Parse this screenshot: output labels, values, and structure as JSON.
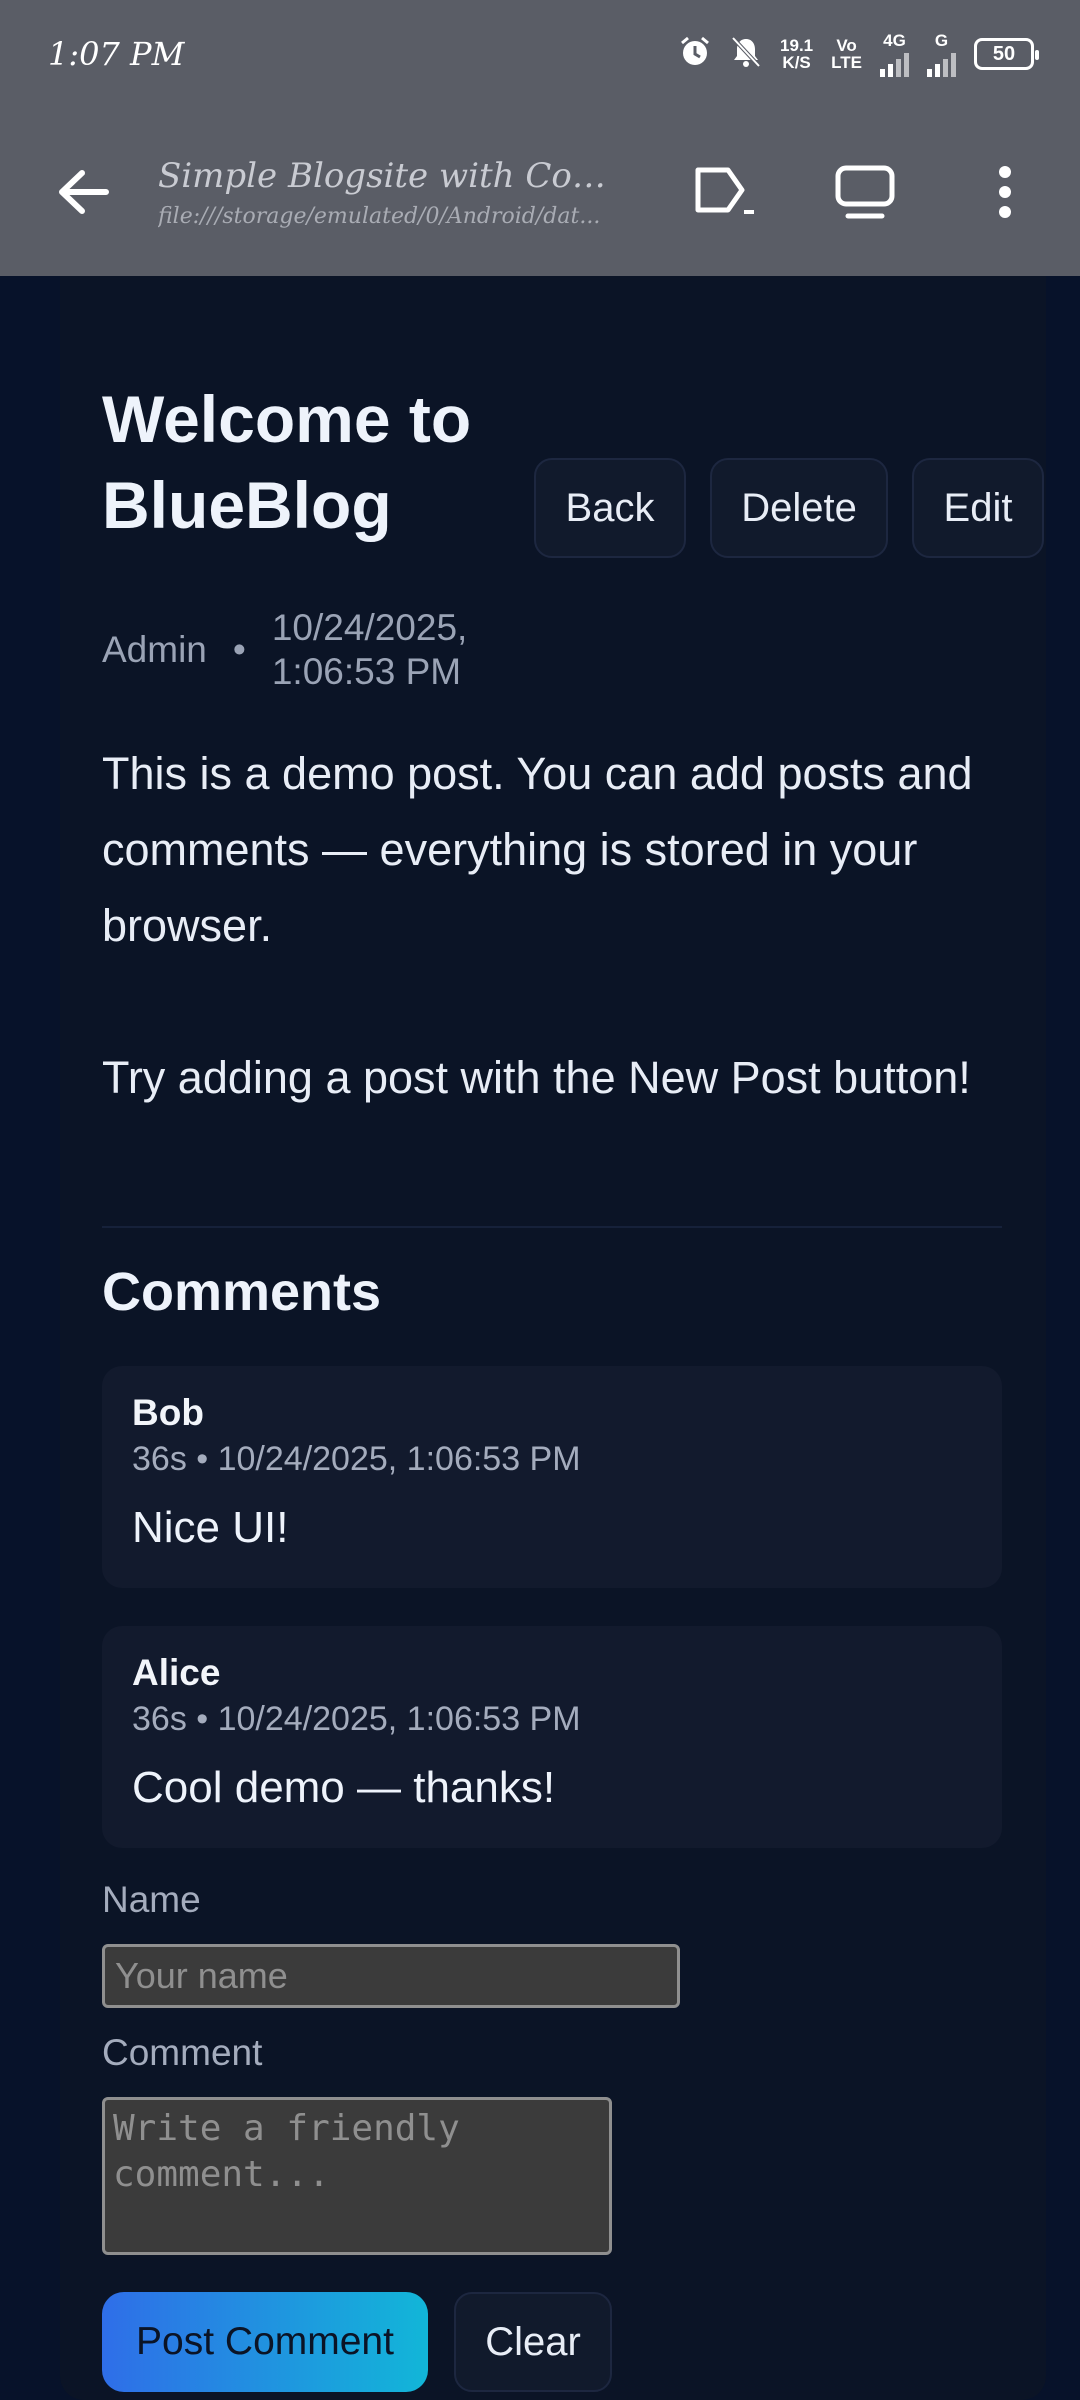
{
  "status_bar": {
    "time": "1:07 PM",
    "net_speed_value": "19.1",
    "net_speed_unit": "K/S",
    "volte_top": "Vo",
    "volte_bottom": "LTE",
    "network_4g": "4G",
    "network_g": "G",
    "battery": "50"
  },
  "browser": {
    "page_title": "Simple Blogsite with Comme...",
    "url": "file:///storage/emulated/0/Android/dat..."
  },
  "post": {
    "title": "Welcome to BlueBlog",
    "author": "Admin",
    "separator": "•",
    "date": "10/24/2025, 1:06:53 PM",
    "body_paragraph_1": "This is a demo post. You can add posts and comments — everything is stored in your browser.",
    "body_paragraph_2": "Try adding a post with the New Post button!"
  },
  "actions": {
    "back_label": "Back",
    "delete_label": "Delete",
    "edit_label": "Edit"
  },
  "comments": {
    "heading": "Comments",
    "items": [
      {
        "author": "Bob",
        "meta": "36s • 10/24/2025, 1:06:53 PM",
        "text": "Nice UI!"
      },
      {
        "author": "Alice",
        "meta": "36s • 10/24/2025, 1:06:53 PM",
        "text": "Cool demo — thanks!"
      }
    ]
  },
  "form": {
    "name_label": "Name",
    "name_placeholder": "Your name",
    "comment_label": "Comment",
    "comment_placeholder": "Write a friendly comment...",
    "post_button": "Post Comment",
    "clear_button": "Clear"
  },
  "colors": {
    "page_background": "#07122a",
    "card_background": "#0b1426",
    "browser_bar": "#5a5d66",
    "accent_gradient_start": "#2f6ee8",
    "accent_gradient_end": "#12b6d8"
  }
}
